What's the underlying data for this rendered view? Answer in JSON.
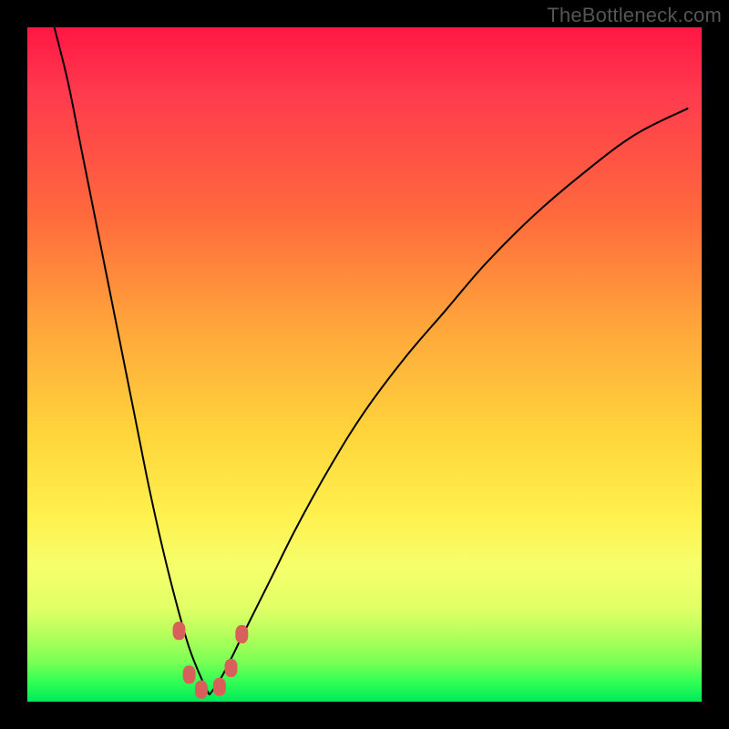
{
  "watermark": "TheBottleneck.com",
  "colors": {
    "frame": "#000000",
    "gradient_top": "#ff1744",
    "gradient_mid1": "#ffa83b",
    "gradient_mid2": "#fff04d",
    "gradient_bottom": "#00e85b",
    "curve": "#000000",
    "marker": "#d9605a"
  },
  "chart_data": {
    "type": "line",
    "title": "",
    "xlabel": "",
    "ylabel": "",
    "xlim": [
      0,
      100
    ],
    "ylim": [
      0,
      100
    ],
    "grid": false,
    "legend": false,
    "note": "V-shaped bottleneck curve. x is horizontal position as % of plot width; y is severity 0 (bottom, good) to 100 (top, bad). Minimum (~y=1) sits around x≈27. Left branch drops from top-left corner; right branch rises from minimum and exits near right edge at y≈88. Six rounded markers cluster near the minimum.",
    "series": [
      {
        "name": "left-branch",
        "x": [
          4,
          6,
          8,
          10,
          12,
          14,
          16,
          18,
          20,
          22,
          24,
          26,
          27
        ],
        "y": [
          100,
          92,
          82,
          72,
          62,
          52,
          42,
          32,
          23,
          15,
          8,
          3,
          1
        ]
      },
      {
        "name": "right-branch",
        "x": [
          27,
          29,
          32,
          36,
          40,
          45,
          50,
          56,
          62,
          68,
          75,
          82,
          90,
          98
        ],
        "y": [
          1,
          4,
          10,
          18,
          26,
          35,
          43,
          51,
          58,
          65,
          72,
          78,
          84,
          88
        ]
      }
    ],
    "markers": [
      {
        "x": 22.5,
        "y": 10.5
      },
      {
        "x": 24.0,
        "y": 4.0
      },
      {
        "x": 25.8,
        "y": 1.8
      },
      {
        "x": 28.5,
        "y": 2.2
      },
      {
        "x": 30.2,
        "y": 5.0
      },
      {
        "x": 31.8,
        "y": 10.0
      }
    ]
  }
}
